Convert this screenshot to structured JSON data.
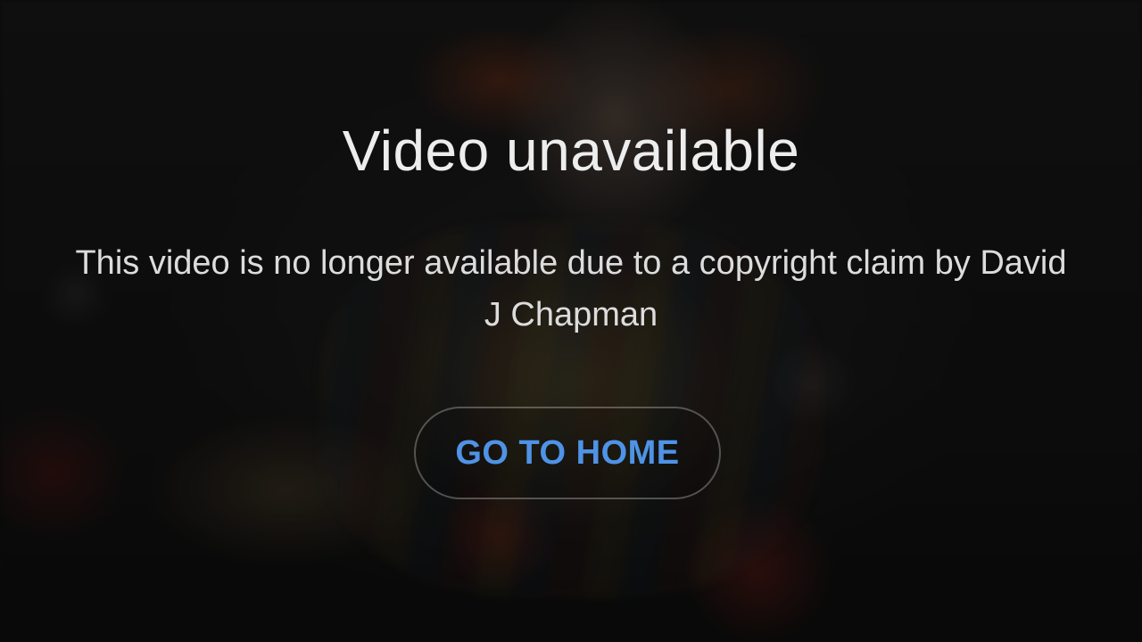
{
  "error": {
    "title": "Video unavailable",
    "message": "This video is no longer available due to a copyright claim by David J Chapman"
  },
  "actions": {
    "home_label": "GO TO HOME"
  },
  "colors": {
    "background": "#0e0e0e",
    "title_text": "#ededed",
    "message_text": "#dcdcdc",
    "button_text": "#4e93e6"
  }
}
